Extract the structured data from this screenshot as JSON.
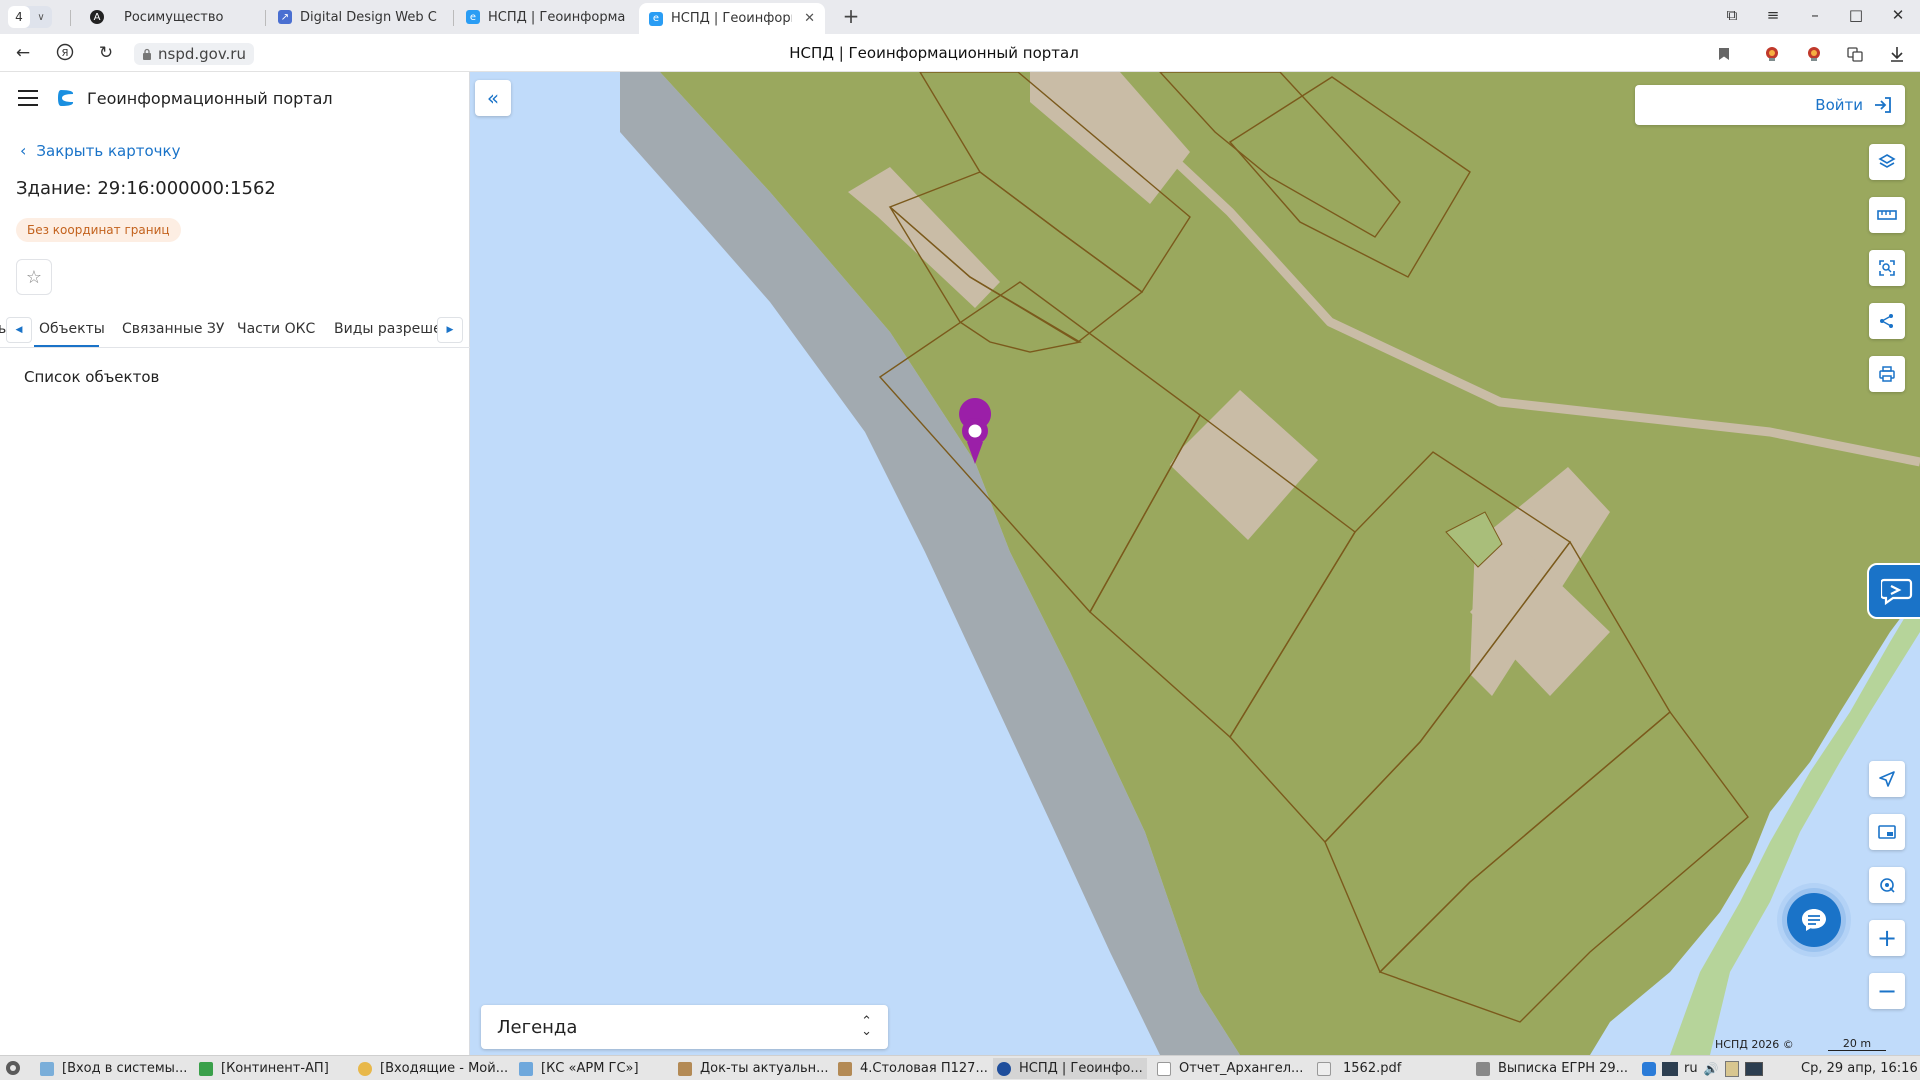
{
  "browser": {
    "tab_count": "4",
    "tabs": [
      {
        "title": "Росимущество",
        "fav_color": "#222222",
        "icon": "shield-logo-icon"
      },
      {
        "title": "Digital Design Web Clie",
        "fav_color": "#4a6fd1",
        "icon": "link-icon"
      },
      {
        "title": "НСПД | Геоинформаци",
        "fav_color": "#2a9df4",
        "icon": "nspd-logo-icon"
      },
      {
        "title": "НСПД | Геоинформа",
        "fav_color": "#2a9df4",
        "icon": "nspd-logo-icon",
        "active": true
      }
    ],
    "url": "nspd.gov.ru",
    "page_title": "НСПД | Геоинформационный портал"
  },
  "sidebar": {
    "portal_title": "Геоинформационный портал",
    "close_label": "Закрыть карточку",
    "object_title": "Здание: 29:16:000000:1562",
    "badge": "Без координат границ",
    "tabs": [
      {
        "label": "Объекты",
        "active": true
      },
      {
        "label": "Связанные ЗУ"
      },
      {
        "label": "Части ОКС"
      },
      {
        "label": "Виды разрешенн"
      }
    ],
    "list_title": "Список объектов"
  },
  "map": {
    "login_label": "Войти",
    "legend_label": "Легенда",
    "copyright": "НСПД 2026 ©",
    "scale_label": "20 m",
    "colors": {
      "water": "#c0dbfa",
      "land": "#9aa85e",
      "shore": "#a2aab0",
      "building": "#c9bca6",
      "parcel_border": "#7b5a1c",
      "marker": "#9b1fa8",
      "accent": "#1a73c8"
    },
    "tools_top": [
      "layers-icon",
      "ruler-icon",
      "area-select-icon",
      "share-icon",
      "print-icon"
    ],
    "tools_bottom": [
      "navigate-icon",
      "picture-in-picture-icon",
      "locate-icon",
      "zoom-in-icon",
      "zoom-out-icon"
    ]
  },
  "taskbar": {
    "items": [
      {
        "label": "[Вход в системы...",
        "color": "#7aaed9"
      },
      {
        "label": "[Континент-АП]",
        "color": "#3aa04a"
      },
      {
        "label": "[Входящие - Мой...",
        "color": "#e8b84a"
      },
      {
        "label": "[КС «АРМ ГС»]",
        "color": "#6fa8dc"
      },
      {
        "label": "Док-ты актуальн...",
        "color": "#b38a55"
      },
      {
        "label": "4.Столовая П127...",
        "color": "#b38a55"
      },
      {
        "label": "НСПД | Геоинфо...",
        "color": "#1f4e9c",
        "active": true
      },
      {
        "label": "Отчет_Архангел...",
        "color": "#ffffff"
      },
      {
        "label": "1562.pdf",
        "color": "#eeeeee"
      },
      {
        "label": "Выписка ЕГРН 29...",
        "color": "#888888"
      }
    ],
    "lang": "ru",
    "clock": "Ср, 29 апр, 16:16"
  }
}
